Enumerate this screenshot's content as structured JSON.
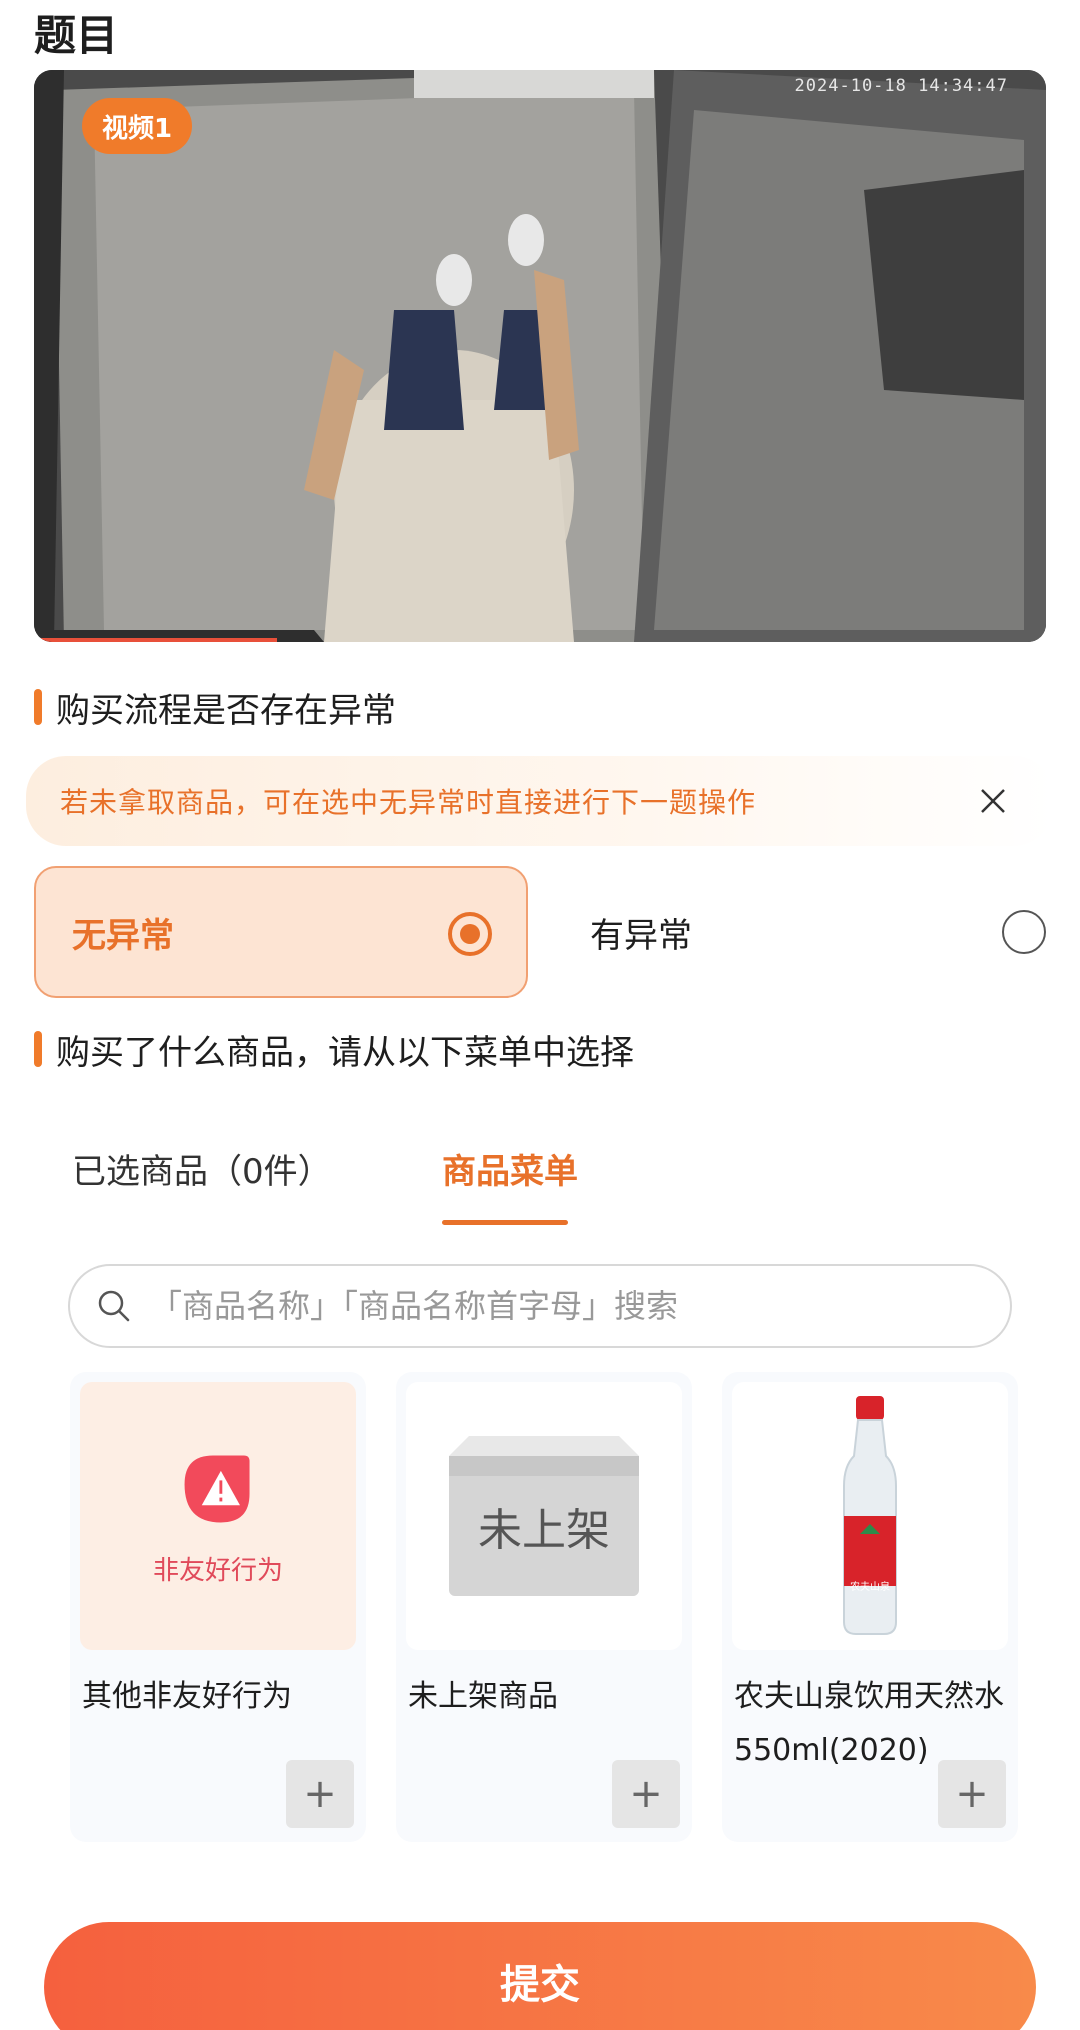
{
  "page": {
    "title": "题目"
  },
  "video": {
    "badge": "视频1",
    "timestamp": "2024-10-18 14:34:47",
    "progress": 0.24
  },
  "q1": {
    "title": "购买流程是否存在异常",
    "notice": "若未拿取商品，可在选中无异常时直接进行下一题操作",
    "options": [
      {
        "label": "无异常",
        "selected": true
      },
      {
        "label": "有异常",
        "selected": false
      }
    ]
  },
  "q2": {
    "title": "购买了什么商品，请从以下菜单中选择"
  },
  "tabs": {
    "selected": "已选商品（0件）",
    "menu": "商品菜单",
    "active": "menu"
  },
  "search": {
    "placeholder": "「商品名称」「商品名称首字母」搜索"
  },
  "products": [
    {
      "name": "其他非友好行为",
      "image_label": "非友好行为",
      "icon": "warning-icon"
    },
    {
      "name": "未上架商品",
      "image_label": "未上架",
      "icon": "box-icon"
    },
    {
      "name": "农夫山泉饮用天然水550ml(2020)",
      "image_label": "农夫山泉",
      "icon": "water-bottle-icon"
    }
  ],
  "submit": {
    "label": "提交"
  },
  "colors": {
    "accent": "#e8712a",
    "submit_start": "#f5603e",
    "submit_end": "#f88a4a"
  }
}
